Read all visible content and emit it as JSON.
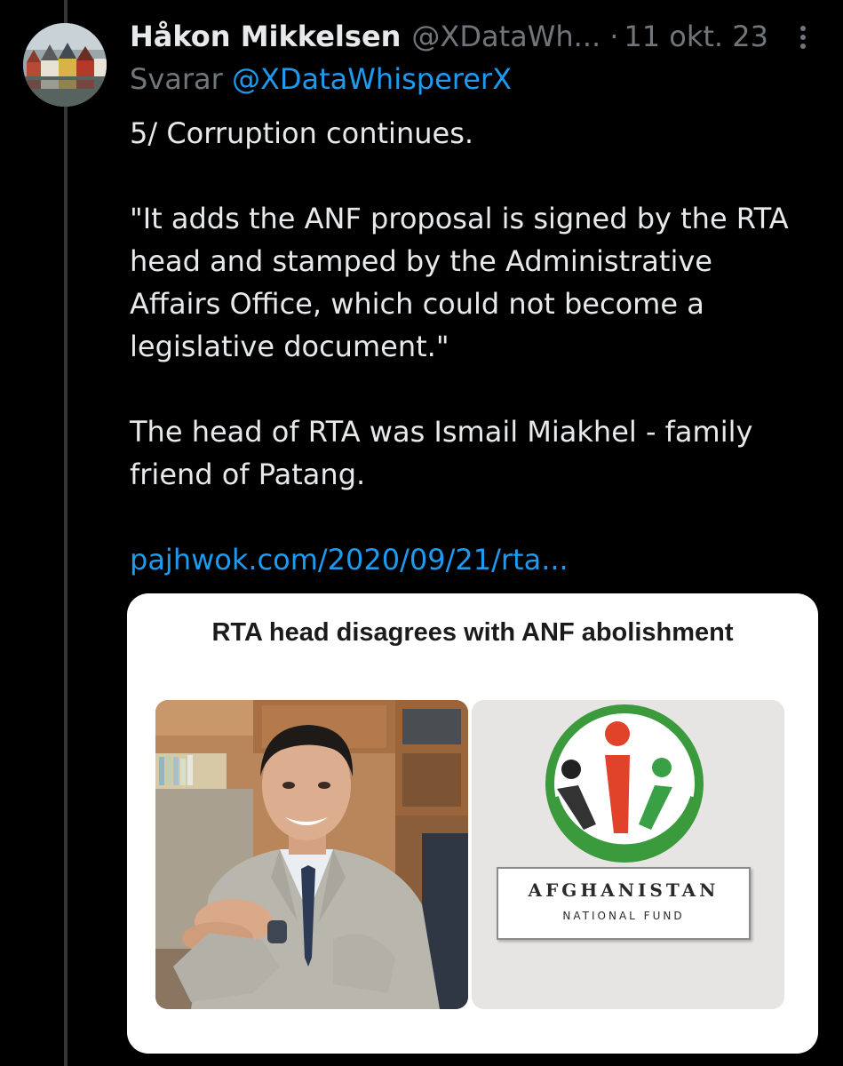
{
  "post": {
    "author_name": "Håkon Mikkelsen",
    "author_handle": "@XDataWh...",
    "separator": "·",
    "date": "11 okt. 23",
    "replying_label": "Svarar",
    "replying_to": "@XDataWhispererX",
    "body_lines": [
      "5/ Corruption continues.",
      "\"It adds the ANF proposal is signed by the RTA",
      "head and stamped by the  Administrative",
      "Affairs Office, which could not become a",
      "legislative document.\"",
      "The head of RTA was Ismail Miakhel - family",
      "friend of Patang."
    ],
    "link_text": "pajhwok.com/2020/09/21/rta..."
  },
  "card": {
    "headline": "RTA head disagrees with ANF abolishment",
    "right_image": {
      "logo_title": "AFGHANISTAN",
      "logo_subtitle": "NATIONAL FUND"
    }
  },
  "icons": {
    "more": "more-vertical-icon",
    "avatar": "avatar-image"
  },
  "colors": {
    "background": "#000000",
    "primary_text": "#e7e9ea",
    "secondary_text": "#71767b",
    "link": "#1d9bf0",
    "card_background": "#ffffff"
  }
}
